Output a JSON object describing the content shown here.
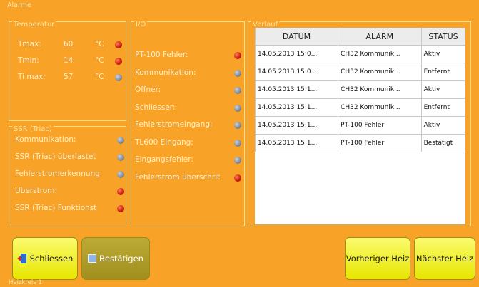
{
  "window_title": "Alarme",
  "temperature": {
    "title": "Temperatur",
    "rows": [
      {
        "label": "Tmax:",
        "value": "60",
        "unit": "°C",
        "status": "red"
      },
      {
        "label": "Tmin:",
        "value": "14",
        "unit": "°C",
        "status": "red"
      },
      {
        "label": "Ti max:",
        "value": "57",
        "unit": "°C",
        "status": "grey"
      }
    ]
  },
  "ssr": {
    "title": "SSR (Triac)",
    "rows": [
      {
        "label": "Kommunikation:",
        "status": "grey"
      },
      {
        "label": "SSR (Triac) überlastet",
        "status": "grey"
      },
      {
        "label": "Fehlerstromerkennung",
        "status": "grey"
      },
      {
        "label": "Überstrom:",
        "status": "red"
      },
      {
        "label": "SSR (Triac) Funktionst",
        "status": "red"
      }
    ]
  },
  "io": {
    "title": "I/O",
    "rows": [
      {
        "label": "PT-100 Fehler:",
        "status": "red"
      },
      {
        "label": "Kommunikation:",
        "status": "grey"
      },
      {
        "label": "Öffner:",
        "status": "grey"
      },
      {
        "label": "Schliesser:",
        "status": "grey"
      },
      {
        "label": "Fehlerstromeingang:",
        "status": "grey"
      },
      {
        "label": "TL600 Eingang:",
        "status": "grey"
      },
      {
        "label": "Eingangsfehler:",
        "status": "grey"
      },
      {
        "label": "Fehlerstrom überschrit",
        "status": "red"
      }
    ]
  },
  "history": {
    "title": "Verlauf",
    "columns": [
      "DATUM",
      "ALARM",
      "STATUS"
    ],
    "rows": [
      [
        "14.05.2013 15:0...",
        "CH32 Kommunik...",
        "Aktiv"
      ],
      [
        "14.05.2013 15:0...",
        "CH32 Kommunik...",
        "Entfernt"
      ],
      [
        "14.05.2013 15:1...",
        "CH32 Kommunik...",
        "Aktiv"
      ],
      [
        "14.05.2013 15:1...",
        "CH32 Kommunik...",
        "Entfernt"
      ],
      [
        "14.05.2013 15:1...",
        "PT-100 Fehler",
        "Aktiv"
      ],
      [
        "14.05.2013 15:1...",
        "PT-100 Fehler",
        "Bestätigt"
      ]
    ]
  },
  "buttons": {
    "close": "Schliessen",
    "confirm": "Bestätigen",
    "prev": "Vorheriger Heiz",
    "next": "Nächster Heiz"
  },
  "footer": "Heizkreis 1",
  "icons": {
    "close": "door-exit-icon",
    "confirm": "confirm-icon"
  }
}
